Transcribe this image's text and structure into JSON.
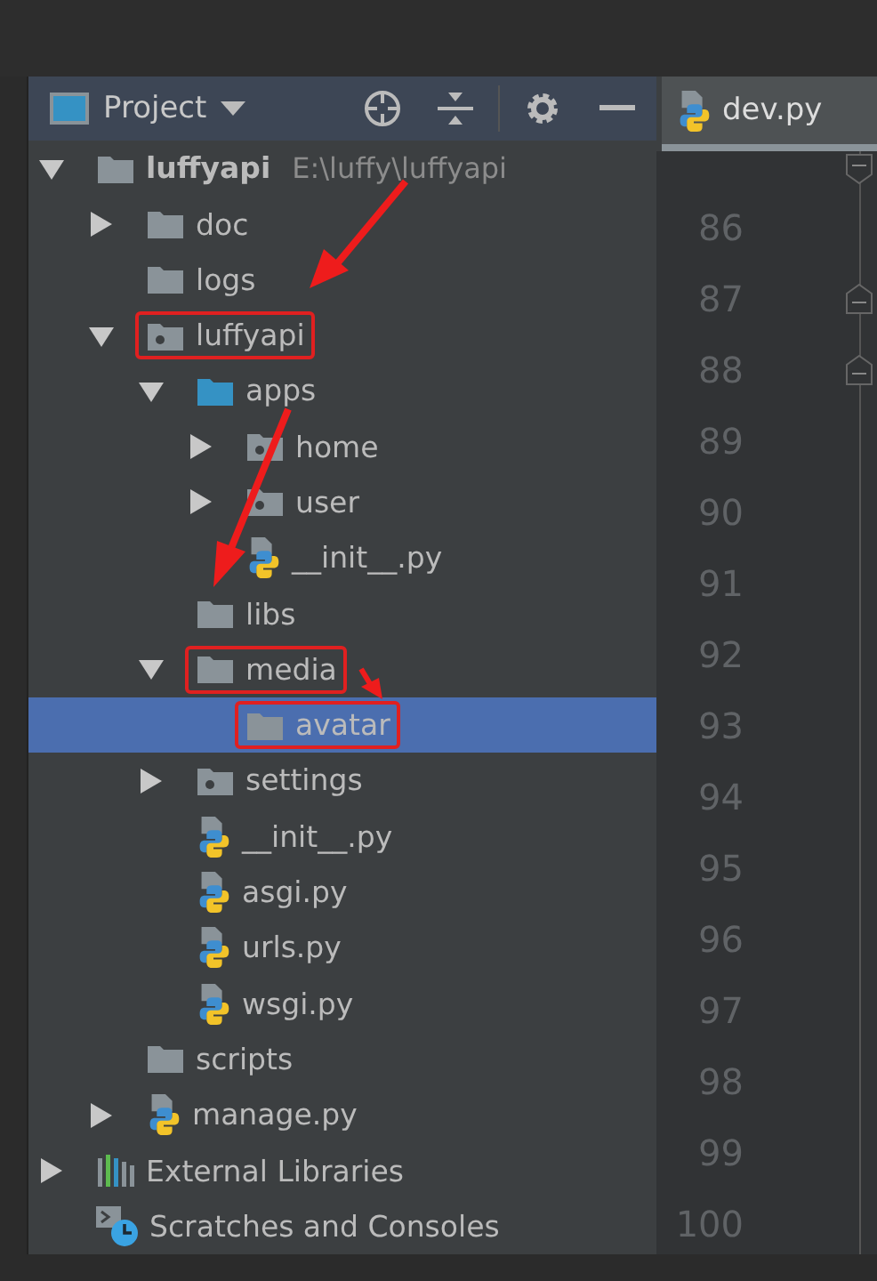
{
  "project_panel": {
    "title": "Project"
  },
  "tree": [
    {
      "label": "luffyapi",
      "path": "E:\\luffy\\luffyapi",
      "kind": "folder",
      "expanded": true,
      "selected": false,
      "annotated": false,
      "children": [
        {
          "label": "doc",
          "kind": "folder",
          "expanded": false,
          "selected": false,
          "annotated": false
        },
        {
          "label": "logs",
          "kind": "folder",
          "selected": false,
          "annotated": false
        },
        {
          "label": "luffyapi",
          "kind": "package",
          "expanded": true,
          "selected": false,
          "annotated": true,
          "children": [
            {
              "label": "apps",
              "kind": "source-folder",
              "expanded": true,
              "selected": false,
              "annotated": false,
              "children": [
                {
                  "label": "home",
                  "kind": "package",
                  "expanded": false,
                  "selected": false,
                  "annotated": false
                },
                {
                  "label": "user",
                  "kind": "package",
                  "expanded": false,
                  "selected": false,
                  "annotated": false
                },
                {
                  "label": "__init__.py",
                  "kind": "python",
                  "selected": false,
                  "annotated": false
                }
              ]
            },
            {
              "label": "libs",
              "kind": "folder",
              "selected": false,
              "annotated": false
            },
            {
              "label": "media",
              "kind": "folder",
              "expanded": true,
              "selected": false,
              "annotated": true,
              "children": [
                {
                  "label": "avatar",
                  "kind": "folder",
                  "selected": true,
                  "annotated": true
                }
              ]
            },
            {
              "label": "settings",
              "kind": "package",
              "expanded": false,
              "selected": false,
              "annotated": false
            },
            {
              "label": "__init__.py",
              "kind": "python",
              "selected": false,
              "annotated": false
            },
            {
              "label": "asgi.py",
              "kind": "python",
              "selected": false,
              "annotated": false
            },
            {
              "label": "urls.py",
              "kind": "python",
              "selected": false,
              "annotated": false
            },
            {
              "label": "wsgi.py",
              "kind": "python",
              "selected": false,
              "annotated": false
            }
          ]
        },
        {
          "label": "scripts",
          "kind": "folder",
          "selected": false,
          "annotated": false
        },
        {
          "label": "manage.py",
          "kind": "python",
          "expanded": false,
          "selected": false,
          "annotated": false
        }
      ]
    },
    {
      "label": "External Libraries",
      "kind": "libraries",
      "expanded": false,
      "selected": false,
      "annotated": false
    },
    {
      "label": "Scratches and Consoles",
      "kind": "scratches",
      "selected": false,
      "annotated": false
    }
  ],
  "editor": {
    "tab": {
      "label": "dev.py",
      "selected": true
    },
    "line_numbers": [
      "86",
      "87",
      "88",
      "89",
      "90",
      "91",
      "92",
      "93",
      "94",
      "95",
      "96",
      "97",
      "98",
      "99",
      "100"
    ]
  }
}
